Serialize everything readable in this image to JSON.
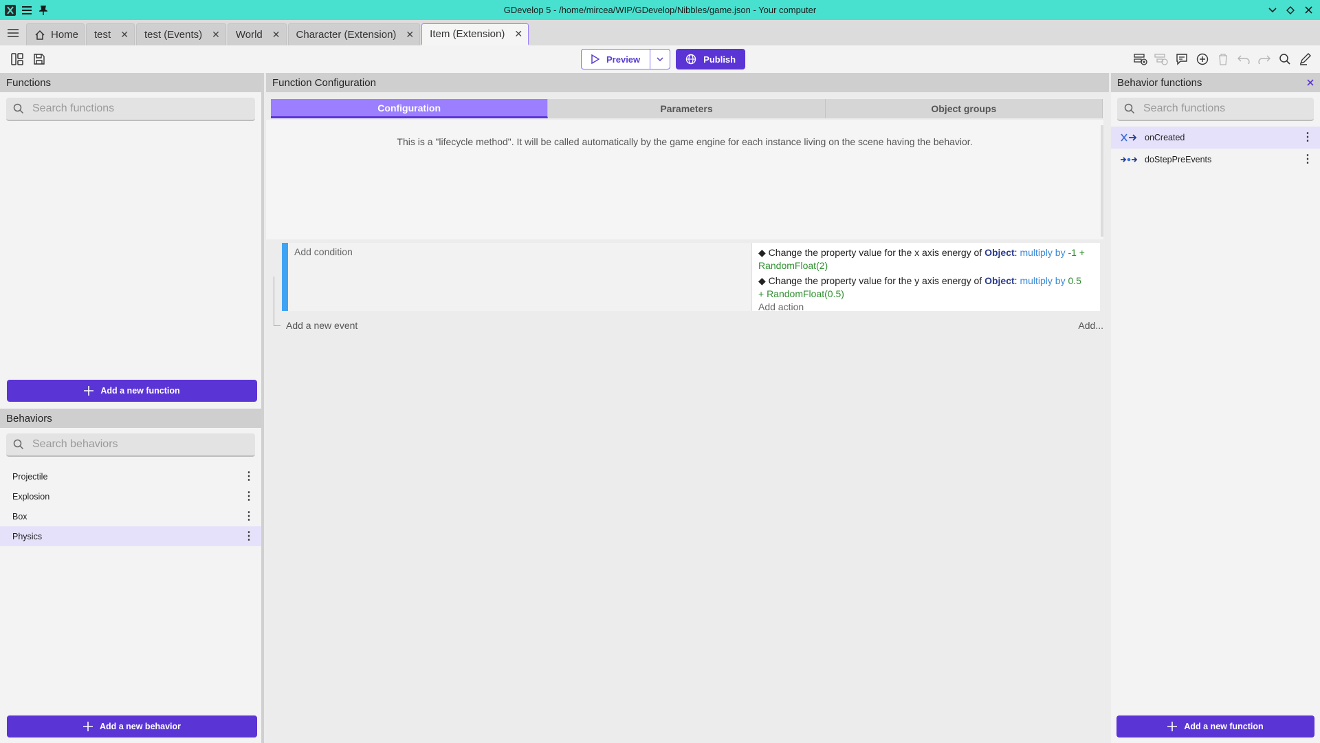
{
  "window": {
    "title": "GDevelop 5 - /home/mircea/WIP/GDevelop/Nibbles/game.json - Your computer"
  },
  "tabs": [
    {
      "label": "Home"
    },
    {
      "label": "test"
    },
    {
      "label": "test (Events)"
    },
    {
      "label": "World"
    },
    {
      "label": "Character (Extension)"
    },
    {
      "label": "Item (Extension)"
    }
  ],
  "toolbar": {
    "preview_label": "Preview",
    "publish_label": "Publish"
  },
  "functions_panel": {
    "title": "Functions",
    "search_placeholder": "Search functions",
    "add_button": "Add a new function"
  },
  "behaviors_panel": {
    "title": "Behaviors",
    "search_placeholder": "Search behaviors",
    "items": [
      {
        "label": "Projectile"
      },
      {
        "label": "Explosion"
      },
      {
        "label": "Box"
      },
      {
        "label": "Physics"
      }
    ],
    "add_button": "Add a new behavior"
  },
  "function_config": {
    "title": "Function Configuration",
    "tabs": [
      {
        "label": "Configuration"
      },
      {
        "label": "Parameters"
      },
      {
        "label": "Object groups"
      }
    ],
    "lifecycle_text": "This is a \"lifecycle method\". It will be called automatically by the game engine for each instance living on the scene having the behavior."
  },
  "event": {
    "add_condition": "Add condition",
    "actions": [
      {
        "text": "Change the property value for the x axis energy of",
        "object": "Object",
        "operator": "multiply by",
        "value": "-1 + RandomFloat(2)"
      },
      {
        "text": "Change the property value for the y axis energy of",
        "object": "Object",
        "operator": "multiply by",
        "value": "0.5 + RandomFloat(0.5)"
      }
    ],
    "add_action": "Add action",
    "add_event": "Add a new event",
    "add_more": "Add..."
  },
  "behavior_functions": {
    "title": "Behavior functions",
    "search_placeholder": "Search functions",
    "items": [
      {
        "label": "onCreated"
      },
      {
        "label": "doStepPreEvents"
      }
    ],
    "add_button": "Add a new function"
  },
  "colors": {
    "accent": "#5b34d6",
    "titlebar": "#48e0cf",
    "event_bar": "#3fa3f3"
  }
}
